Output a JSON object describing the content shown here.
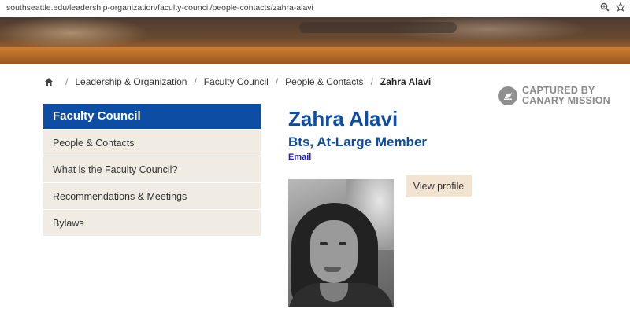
{
  "browser": {
    "url": "southseattle.edu/leadership-organization/faculty-council/people-contacts/zahra-alavi",
    "zoom_icon": "zoom-icon",
    "bookmark_icon": "star-icon"
  },
  "breadcrumb": {
    "home_icon": "home-icon",
    "items": [
      "Leadership & Organization",
      "Faculty Council",
      "People & Contacts"
    ],
    "current": "Zahra Alavi"
  },
  "watermark": {
    "line1": "CAPTURED BY",
    "line2": "CANARY MISSION"
  },
  "sidebar": {
    "title": "Faculty Council",
    "items": [
      {
        "label": "People & Contacts"
      },
      {
        "label": "What is the Faculty Council?"
      },
      {
        "label": "Recommendations & Meetings"
      },
      {
        "label": "Bylaws"
      }
    ]
  },
  "profile": {
    "name": "Zahra Alavi",
    "role": "Bts, At-Large Member",
    "email_label": "Email",
    "view_profile_label": "View profile"
  },
  "colors": {
    "brand_blue": "#0d4da3",
    "sidebar_bg": "#f1ece3",
    "button_bg": "#f3e3d1",
    "link_blue": "#1a1aee"
  }
}
